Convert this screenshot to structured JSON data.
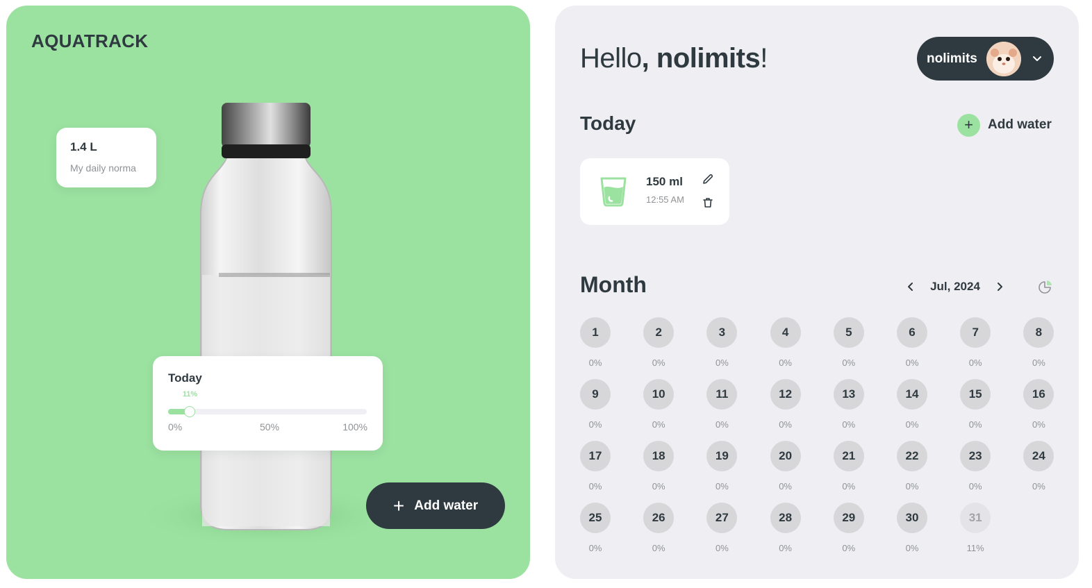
{
  "app": {
    "logo": "AQUATRACK"
  },
  "daily_norma": {
    "value": "1.4 L",
    "label": "My daily norma"
  },
  "today_progress": {
    "title": "Today",
    "percent": 11,
    "percent_label": "11%",
    "scale": [
      "0%",
      "50%",
      "100%"
    ]
  },
  "left_add_button": {
    "label": "Add water"
  },
  "header": {
    "hello": "Hello",
    "user_name": "nolimits",
    "user_menu_name": "nolimits"
  },
  "today_section": {
    "title": "Today",
    "add_label": "Add water",
    "entries": [
      {
        "amount": "150 ml",
        "time": "12:55 AM"
      }
    ]
  },
  "month_section": {
    "title": "Month",
    "month_label": "Jul, 2024",
    "days": [
      {
        "day": "1",
        "pct": "0%"
      },
      {
        "day": "2",
        "pct": "0%"
      },
      {
        "day": "3",
        "pct": "0%"
      },
      {
        "day": "4",
        "pct": "0%"
      },
      {
        "day": "5",
        "pct": "0%"
      },
      {
        "day": "6",
        "pct": "0%"
      },
      {
        "day": "7",
        "pct": "0%"
      },
      {
        "day": "8",
        "pct": "0%"
      },
      {
        "day": "9",
        "pct": "0%"
      },
      {
        "day": "10",
        "pct": "0%"
      },
      {
        "day": "11",
        "pct": "0%"
      },
      {
        "day": "12",
        "pct": "0%"
      },
      {
        "day": "13",
        "pct": "0%"
      },
      {
        "day": "14",
        "pct": "0%"
      },
      {
        "day": "15",
        "pct": "0%"
      },
      {
        "day": "16",
        "pct": "0%"
      },
      {
        "day": "17",
        "pct": "0%"
      },
      {
        "day": "18",
        "pct": "0%"
      },
      {
        "day": "19",
        "pct": "0%"
      },
      {
        "day": "20",
        "pct": "0%"
      },
      {
        "day": "21",
        "pct": "0%"
      },
      {
        "day": "22",
        "pct": "0%"
      },
      {
        "day": "23",
        "pct": "0%"
      },
      {
        "day": "24",
        "pct": "0%"
      },
      {
        "day": "25",
        "pct": "0%"
      },
      {
        "day": "26",
        "pct": "0%"
      },
      {
        "day": "27",
        "pct": "0%"
      },
      {
        "day": "28",
        "pct": "0%"
      },
      {
        "day": "29",
        "pct": "0%"
      },
      {
        "day": "30",
        "pct": "0%"
      },
      {
        "day": "31",
        "pct": "11%",
        "current": true
      }
    ]
  },
  "colors": {
    "accent": "#9be1a0",
    "dark": "#2f3a40",
    "panel": "#efeff3",
    "muted": "#8f9296"
  },
  "icons": [
    "plus-icon",
    "chevron-down-icon",
    "glass-icon",
    "pencil-icon",
    "trash-icon",
    "chevron-left-icon",
    "chevron-right-icon",
    "pie-chart-icon"
  ]
}
